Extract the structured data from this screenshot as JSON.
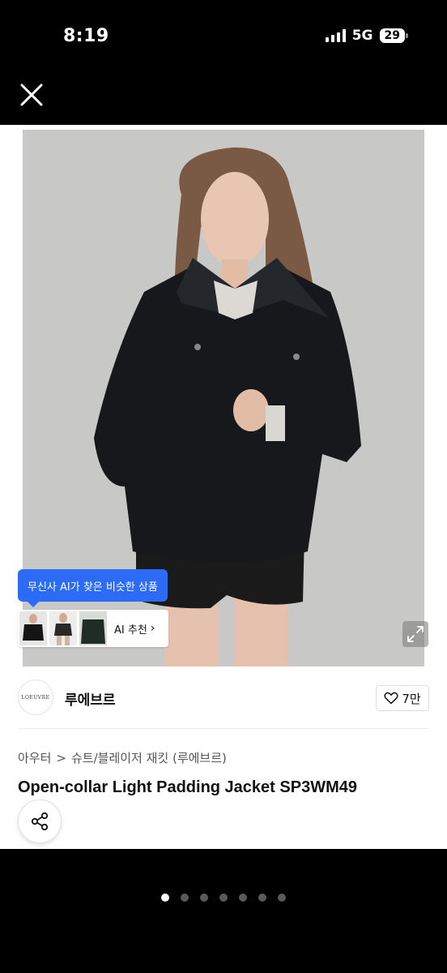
{
  "status_bar": {
    "time": "8:19",
    "network": "5G",
    "battery": "29"
  },
  "ai_similar": {
    "tooltip": "무신사 AI가 찾은 비슷한 상품",
    "button_label": "AI 추천",
    "chevron": "›"
  },
  "brand": {
    "logo_text": "LOEUVRE",
    "name": "루에브르",
    "likes": "7만"
  },
  "breadcrumb": {
    "category": "아우터",
    "separator": ">",
    "subcategory": "슈트/블레이저 재킷 (루에브르)"
  },
  "product": {
    "title": "Open-collar Light Padding Jacket SP3WM49"
  },
  "pager": {
    "count": 7,
    "active_index": 0
  },
  "icons": {
    "close": "close-icon",
    "heart": "heart-icon",
    "share": "share-icon",
    "expand": "expand-icon"
  },
  "colors": {
    "accent": "#2c6bf5",
    "background": "#000000",
    "sheet": "#ffffff"
  }
}
